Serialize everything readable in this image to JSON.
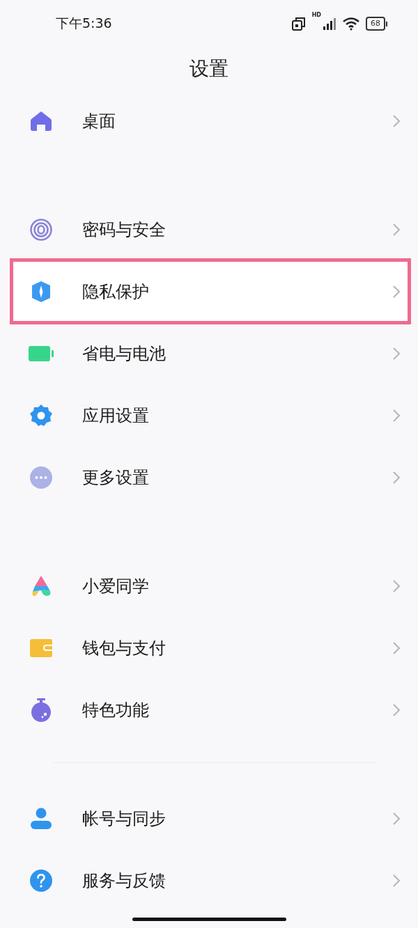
{
  "status_bar": {
    "time": "下午5:36",
    "network_label": "HD",
    "battery": "68"
  },
  "title": "设置",
  "groups": [
    {
      "items": [
        {
          "label": "桌面",
          "highlighted": false
        }
      ]
    },
    {
      "items": [
        {
          "label": "密码与安全",
          "highlighted": false
        },
        {
          "label": "隐私保护",
          "highlighted": true
        },
        {
          "label": "省电与电池",
          "highlighted": false
        },
        {
          "label": "应用设置",
          "highlighted": false
        },
        {
          "label": "更多设置",
          "highlighted": false
        }
      ]
    },
    {
      "items": [
        {
          "label": "小爱同学",
          "highlighted": false
        },
        {
          "label": "钱包与支付",
          "highlighted": false
        },
        {
          "label": "特色功能",
          "highlighted": false
        }
      ]
    },
    {
      "items": [
        {
          "label": "帐号与同步",
          "highlighted": false
        },
        {
          "label": "服务与反馈",
          "highlighted": false
        }
      ]
    }
  ]
}
